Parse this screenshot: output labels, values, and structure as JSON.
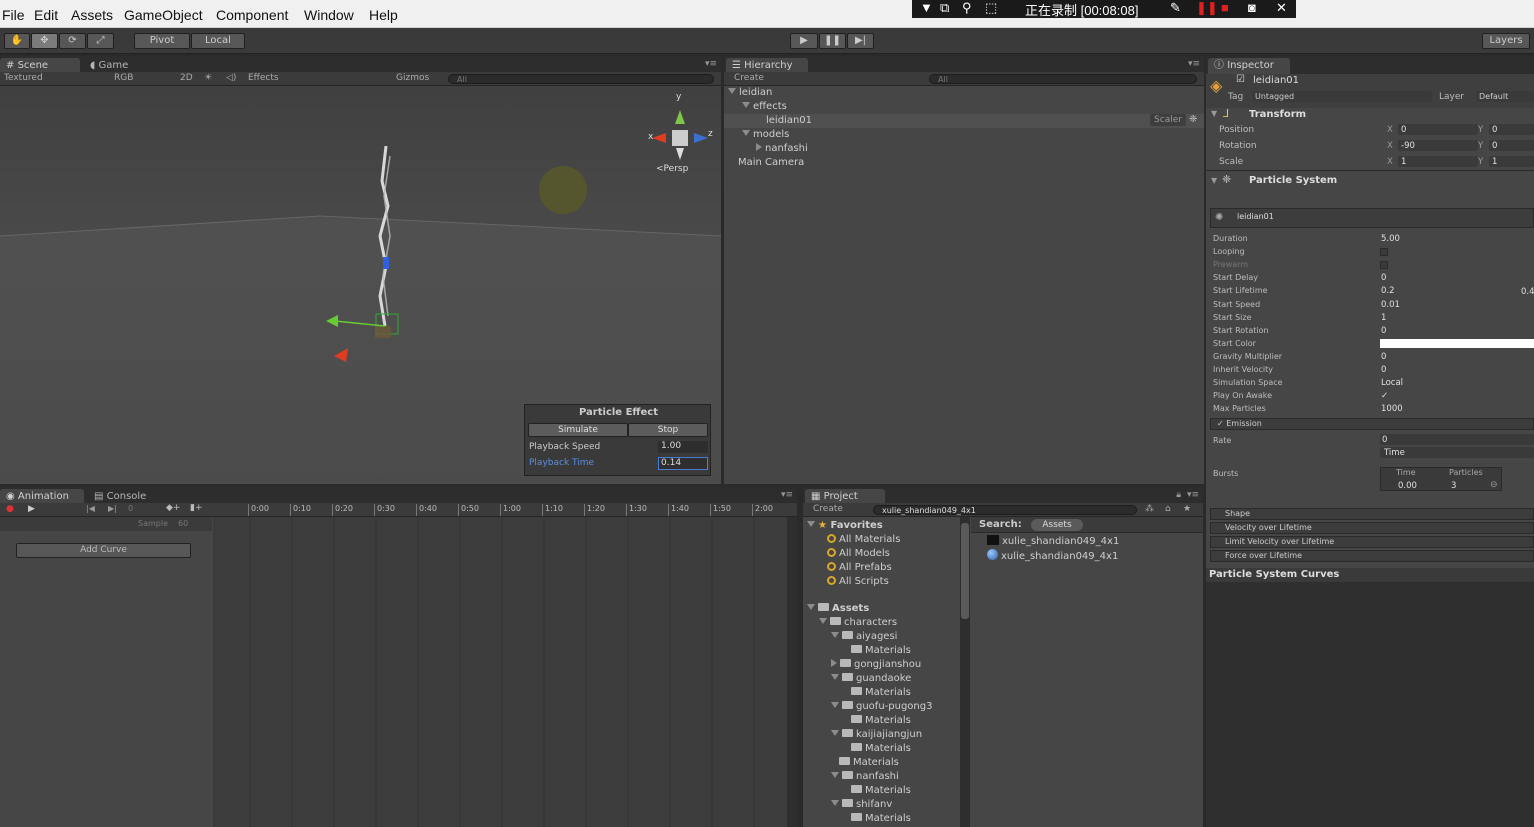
{
  "menu": [
    "File",
    "Edit",
    "Assets",
    "GameObject",
    "Component",
    "Window",
    "Help"
  ],
  "recorder": {
    "status": "正在录制 [00:08:08]"
  },
  "toolbar": {
    "pivot": "Pivot",
    "local": "Local",
    "layers": "Layers"
  },
  "scene": {
    "tabs": [
      "Scene",
      "Game"
    ],
    "subbar": {
      "shading": "Textured",
      "render": "RGB",
      "mode2d": "2D",
      "effects": "Effects",
      "gizmos": "Gizmos",
      "search": "All"
    },
    "gizmo": {
      "y": "y",
      "x": "x",
      "z": "z",
      "projection": "Persp"
    },
    "particle_effect": {
      "title": "Particle Effect",
      "simulate": "Simulate",
      "stop": "Stop",
      "playback_speed_label": "Playback Speed",
      "playback_speed": "1.00",
      "playback_time_label": "Playback Time",
      "playback_time": "0.14"
    }
  },
  "hierarchy": {
    "tab": "Hierarchy",
    "create": "Create",
    "search": "All",
    "items": [
      "leidian",
      "effects",
      "leidian01",
      "models",
      "nanfashi",
      "Main Camera"
    ],
    "scaler": "Scaler"
  },
  "inspector": {
    "tab": "Inspector",
    "object_name": "leidian01",
    "tag_label": "Tag",
    "tag_value": "Untagged",
    "layer_label": "Layer",
    "layer_value": "Default",
    "transform": {
      "title": "Transform",
      "rows": [
        {
          "label": "Position",
          "x": "0",
          "y": "0"
        },
        {
          "label": "Rotation",
          "x": "-90",
          "y": "0"
        },
        {
          "label": "Scale",
          "x": "1",
          "y": "1"
        }
      ],
      "x": "X",
      "y": "Y"
    },
    "particle_system": {
      "title": "Particle System",
      "name": "leidian01",
      "rows": [
        {
          "label": "Duration",
          "value": "5.00"
        },
        {
          "label": "Looping",
          "value": ""
        },
        {
          "label": "Prewarm",
          "value": ""
        },
        {
          "label": "Start Delay",
          "value": "0"
        },
        {
          "label": "Start Lifetime",
          "value": "0.2"
        },
        {
          "label": "Start Speed",
          "value": "0.01"
        },
        {
          "label": "Start Size",
          "value": "1"
        },
        {
          "label": "Start Rotation",
          "value": "0"
        },
        {
          "label": "Start Color",
          "value": ""
        },
        {
          "label": "Gravity Multiplier",
          "value": "0"
        },
        {
          "label": "Inherit Velocity",
          "value": "0"
        },
        {
          "label": "Simulation Space",
          "value": "Local"
        },
        {
          "label": "Play On Awake",
          "value": "✓"
        },
        {
          "label": "Max Particles",
          "value": "1000"
        }
      ],
      "start_lifetime_max": "0.4",
      "emission": "Emission",
      "rate_label": "Rate",
      "rate_value": "0",
      "rate_unit": "Time",
      "bursts_label": "Bursts",
      "bursts_col_time": "Time",
      "bursts_col_particles": "Particles",
      "burst_time": "0.00",
      "burst_particles": "3",
      "modules": [
        "Shape",
        "Velocity over Lifetime",
        "Limit Velocity over Lifetime",
        "Force over Lifetime"
      ],
      "curves": "Particle System Curves"
    }
  },
  "animation": {
    "tabs": [
      "Animation",
      "Console"
    ],
    "frame": "0",
    "sample_label": "Sample",
    "sample_value": "60",
    "add_curve": "Add Curve",
    "ticks": [
      "0:00",
      "0:10",
      "0:20",
      "0:30",
      "0:40",
      "0:50",
      "1:00",
      "1:10",
      "1:20",
      "1:30",
      "1:40",
      "1:50",
      "2:00"
    ]
  },
  "project": {
    "tab": "Project",
    "create": "Create",
    "search_value": "xulie_shandian049_4x1",
    "favorites_label": "Favorites",
    "favorites": [
      "All Materials",
      "All Models",
      "All Prefabs",
      "All Scripts"
    ],
    "assets_label": "Assets",
    "tree": [
      {
        "name": "characters",
        "level": 1,
        "open": true
      },
      {
        "name": "aiyagesi",
        "level": 2,
        "open": true
      },
      {
        "name": "Materials",
        "level": 3
      },
      {
        "name": "gongjianshou",
        "level": 2,
        "open": false
      },
      {
        "name": "guandaoke",
        "level": 2,
        "open": true
      },
      {
        "name": "Materials",
        "level": 3
      },
      {
        "name": "guofu-pugong3",
        "level": 2,
        "open": true
      },
      {
        "name": "Materials",
        "level": 3
      },
      {
        "name": "kaijiajiangjun",
        "level": 2,
        "open": true
      },
      {
        "name": "Materials",
        "level": 3
      },
      {
        "name": "Materials",
        "level": 2
      },
      {
        "name": "nanfashi",
        "level": 2,
        "open": true
      },
      {
        "name": "Materials",
        "level": 3
      },
      {
        "name": "shifanv",
        "level": 2,
        "open": true
      },
      {
        "name": "Materials",
        "level": 3
      }
    ],
    "search_label": "Search:",
    "search_scope": "Assets",
    "results": [
      "xulie_shandian049_4x1",
      "xulie_shandian049_4x1"
    ]
  },
  "colors": {
    "accent": "#3d6fb3",
    "panel": "#464646",
    "dark": "#2d2d2d"
  }
}
